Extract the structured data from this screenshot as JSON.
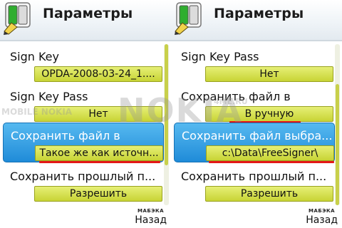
{
  "left_screen": {
    "title": "Параметры",
    "items": [
      {
        "label": "Sign Key",
        "value": "OPDA-2008-03-24_1...."
      },
      {
        "label": "Sign Key Pass",
        "value": "Нет"
      },
      {
        "label": "Сохранить файл в",
        "value": "Такое же как источн..."
      },
      {
        "label": "Сохранить прошлый п...",
        "value": "Разрешить"
      }
    ],
    "selected_index": 2,
    "scroll_position": 0.0,
    "brand": "МАБЭКА",
    "softkey_right": "Назад"
  },
  "right_screen": {
    "title": "Параметры",
    "items": [
      {
        "label": "Sign Key Pass",
        "value": "Нет"
      },
      {
        "label": "Сохранить файл в",
        "value": "В ручную"
      },
      {
        "label": "Сохранить файл выбра...",
        "value": "c:\\Data\\FreeSigner\\"
      },
      {
        "label": "Сохранить прошлый п...",
        "value": "Разрешить"
      }
    ],
    "selected_index": 2,
    "scroll_position": 1.0,
    "brand": "МАБЭКА",
    "softkey_right": "Назад"
  },
  "watermark": {
    "text": "NOKIA",
    "sub": "4ME.RU",
    "side": "MOBILE NOKIA"
  },
  "colors": {
    "selection": "#1f8bd8",
    "value_box": "#d2dc45",
    "highlight_underline": "#e41818"
  }
}
